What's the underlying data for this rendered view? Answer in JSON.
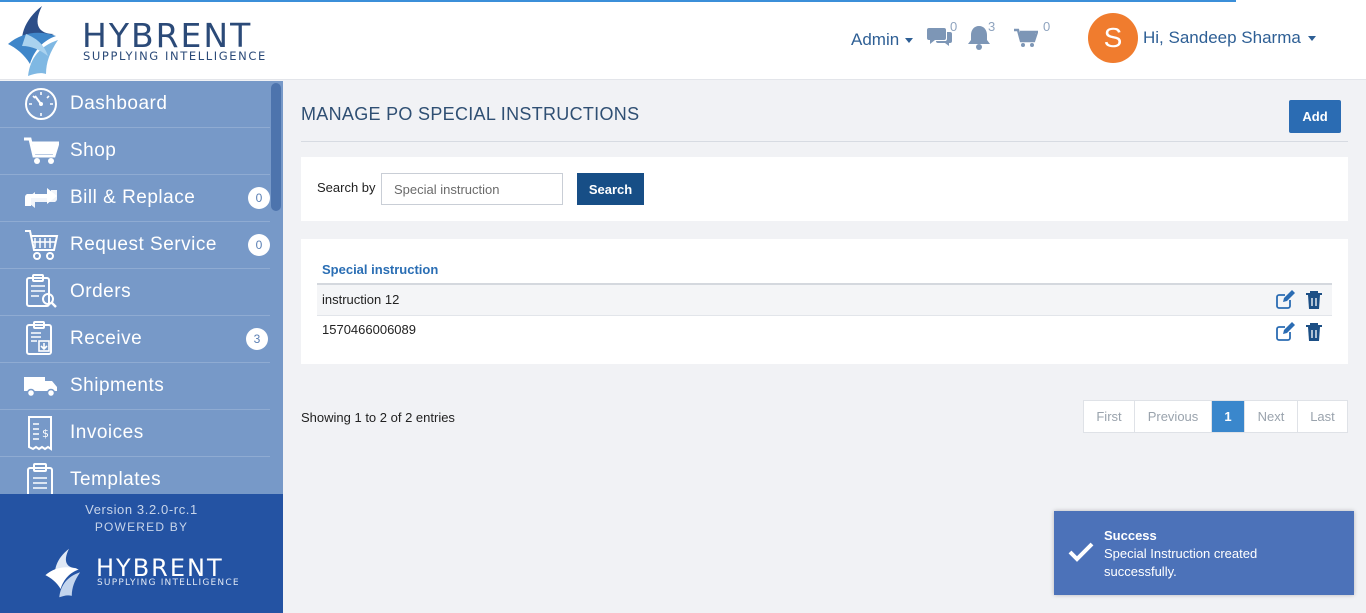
{
  "header": {
    "brand_title": "HYBRENT",
    "brand_subtitle": "SUPPLYING INTELLIGENCE",
    "admin_label": "Admin",
    "messages_count": "0",
    "notifications_count": "3",
    "cart_count": "0",
    "avatar_letter": "S",
    "user_greeting": "Hi, Sandeep Sharma"
  },
  "sidebar": {
    "items": [
      {
        "label": "Dashboard",
        "icon": "dashboard-icon",
        "badge": null
      },
      {
        "label": "Shop",
        "icon": "cart-icon",
        "badge": null
      },
      {
        "label": "Bill & Replace",
        "icon": "replace-icon",
        "badge": "0"
      },
      {
        "label": "Request Service",
        "icon": "service-icon",
        "badge": "0"
      },
      {
        "label": "Orders",
        "icon": "orders-icon",
        "badge": null
      },
      {
        "label": "Receive",
        "icon": "receive-icon",
        "badge": "3"
      },
      {
        "label": "Shipments",
        "icon": "truck-icon",
        "badge": null
      },
      {
        "label": "Invoices",
        "icon": "invoice-icon",
        "badge": null
      },
      {
        "label": "Templates",
        "icon": "templates-icon",
        "badge": null
      }
    ],
    "version": "Version 3.2.0-rc.1",
    "powered_by": "POWERED BY",
    "footer_brand": "HYBRENT",
    "footer_sub": "SUPPLYING INTELLIGENCE"
  },
  "main": {
    "title": "MANAGE PO SPECIAL INSTRUCTIONS",
    "add_label": "Add",
    "search": {
      "label": "Search by",
      "placeholder": "Special instruction",
      "button_label": "Search"
    },
    "table": {
      "column": "Special instruction",
      "rows": [
        "instruction 12",
        "1570466006089"
      ]
    },
    "showing": "Showing 1 to 2 of 2 entries",
    "pagination": [
      "First",
      "Previous",
      "1",
      "Next",
      "Last"
    ]
  },
  "toast": {
    "title": "Success",
    "message": "Special Instruction created successfully."
  },
  "colors": {
    "sidebar_bg": "#7799c8",
    "sidebar_footer": "#2453a3",
    "primary": "#2b6cb3",
    "avatar": "#f07c2e"
  }
}
